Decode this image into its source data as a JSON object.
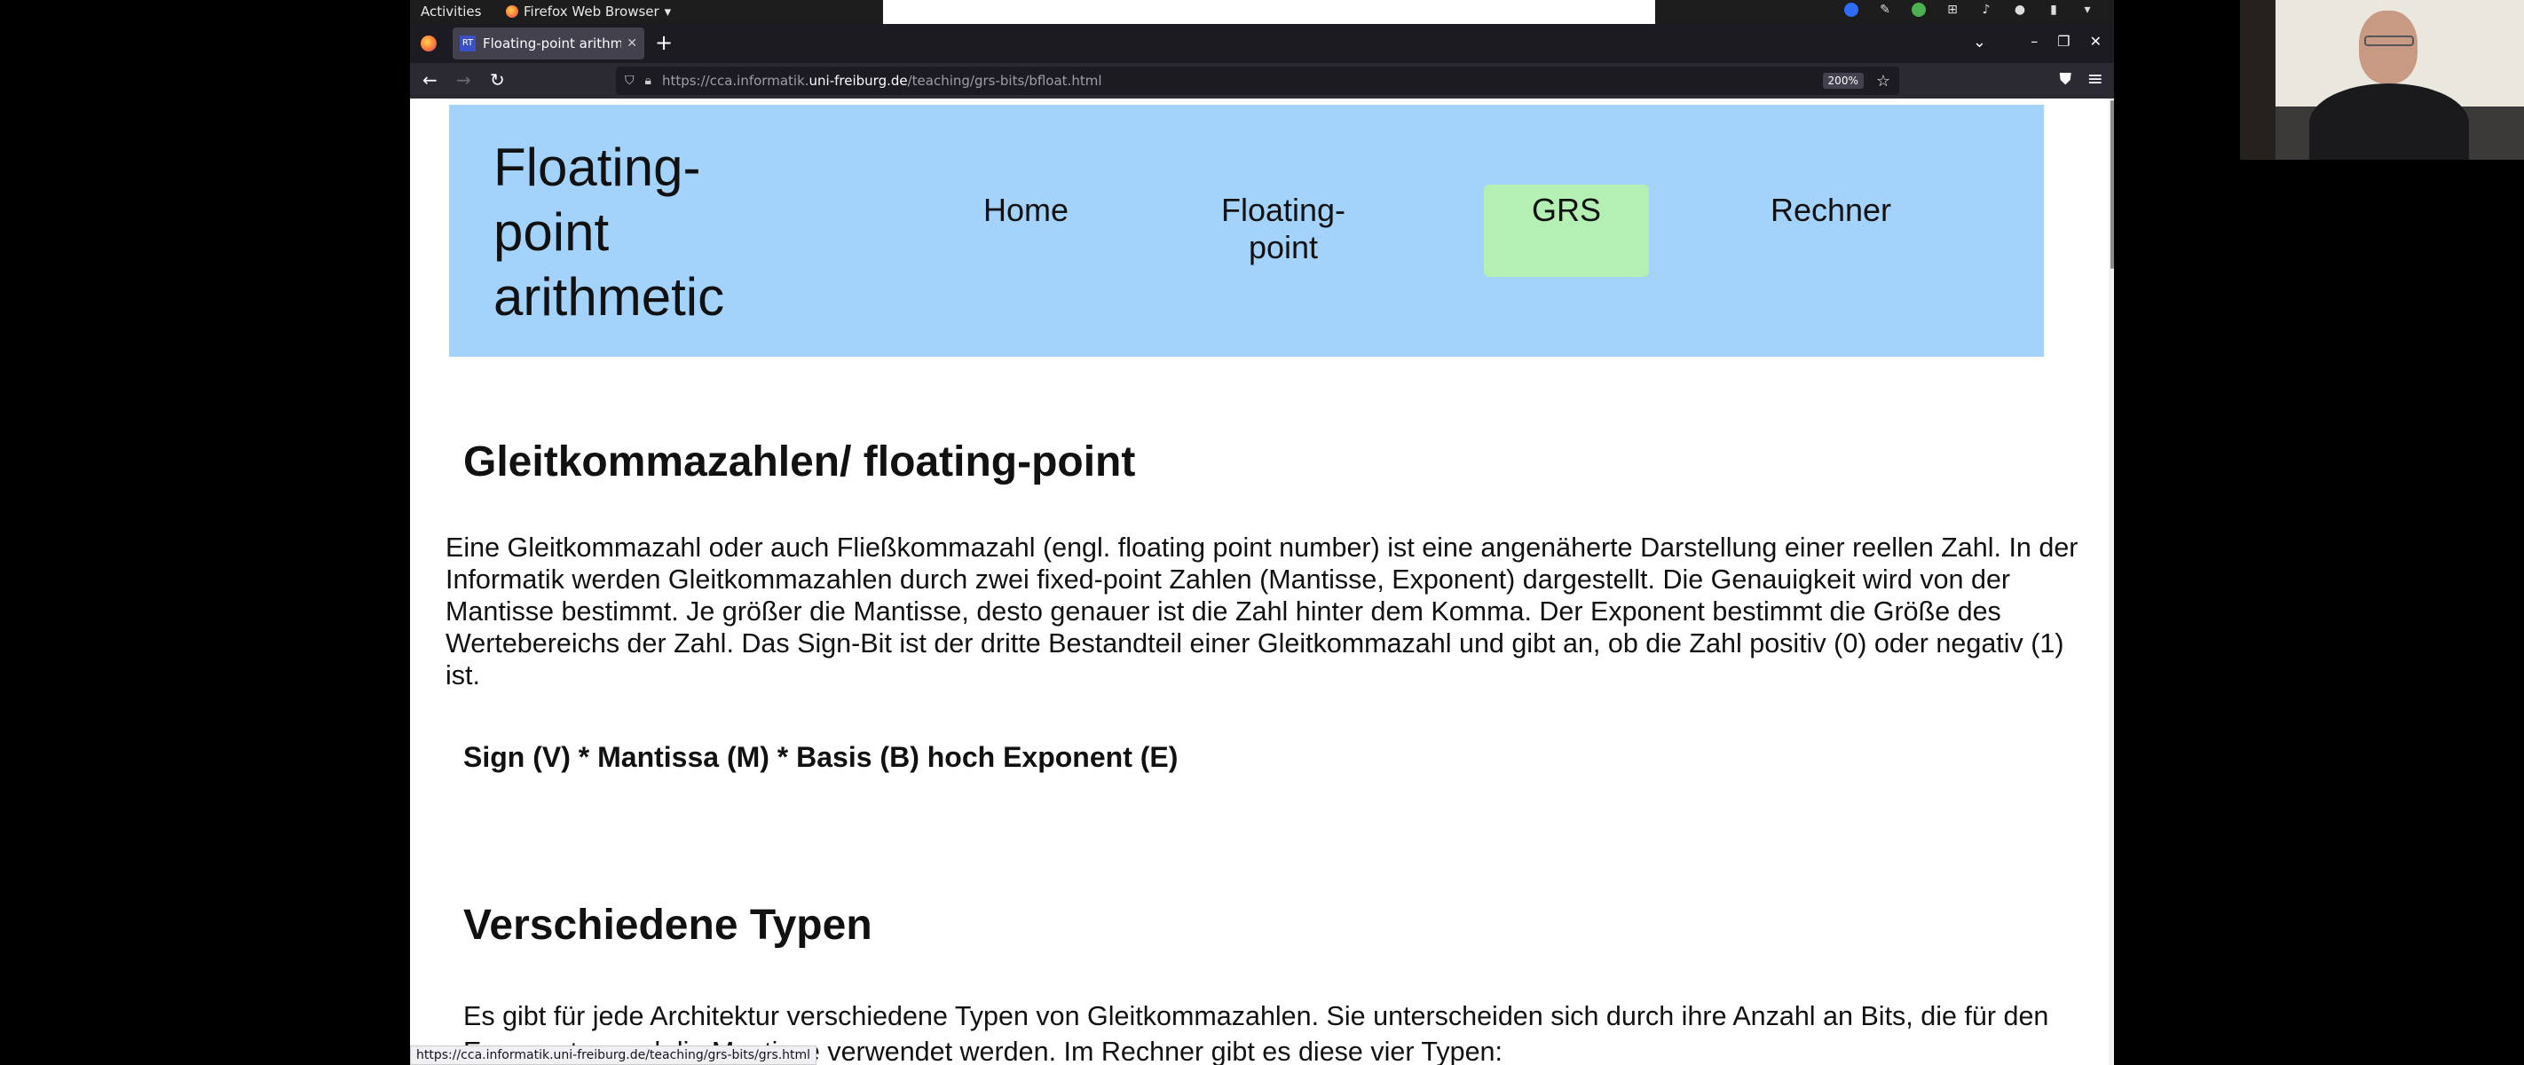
{
  "topbar": {
    "activities": "Activities",
    "app_menu": "Firefox Web Browser"
  },
  "browser": {
    "tab_title": "Floating-point arithmetic",
    "tab_favicon": "RT",
    "url_prefix": "https://cca.informatik.",
    "url_domain": "uni-freiburg.de",
    "url_path": "/teaching/grs-bits/bfloat.html",
    "zoom": "200%",
    "status_url": "https://cca.informatik.uni-freiburg.de/teaching/grs-bits/grs.html"
  },
  "page": {
    "site_title": "Floating-point arithmetic",
    "nav": {
      "home": "Home",
      "floating_point": "Floating-point",
      "grs": "GRS",
      "rechner": "Rechner"
    },
    "heading1": "Gleitkommazahlen/ floating-point",
    "paragraph1": "Eine Gleitkommazahl oder auch Fließkommazahl (engl. floating point number) ist eine angenäherte Darstellung einer reellen Zahl. In der Informatik werden Gleitkommazahlen durch zwei fixed-point Zahlen (Mantisse, Exponent) dargestellt. Die Genauigkeit wird von der Mantisse bestimmt. Je größer die Mantisse, desto genauer ist die Zahl hinter dem Komma. Der Exponent bestimmt die Größe des Wertebereichs der Zahl. Das Sign-Bit ist der dritte Bestandteil einer Gleitkommazahl und gibt an, ob die Zahl positiv (0) oder negativ (1) ist.",
    "formula": "Sign (V) * Mantissa (M) * Basis (B) hoch Exponent (E)",
    "heading2": "Verschiedene Typen",
    "paragraph2": "Es gibt für jede Architektur verschiedene Typen von Gleitkommazahlen. Sie unterscheiden sich durch ihre Anzahl an Bits, die für den Exponenten und die Mantisse verwendet werden. Im Rechner gibt es diese vier Typen:"
  },
  "colors": {
    "header_bg": "#a3d2fb",
    "nav_active_bg": "#b4f0b4"
  }
}
